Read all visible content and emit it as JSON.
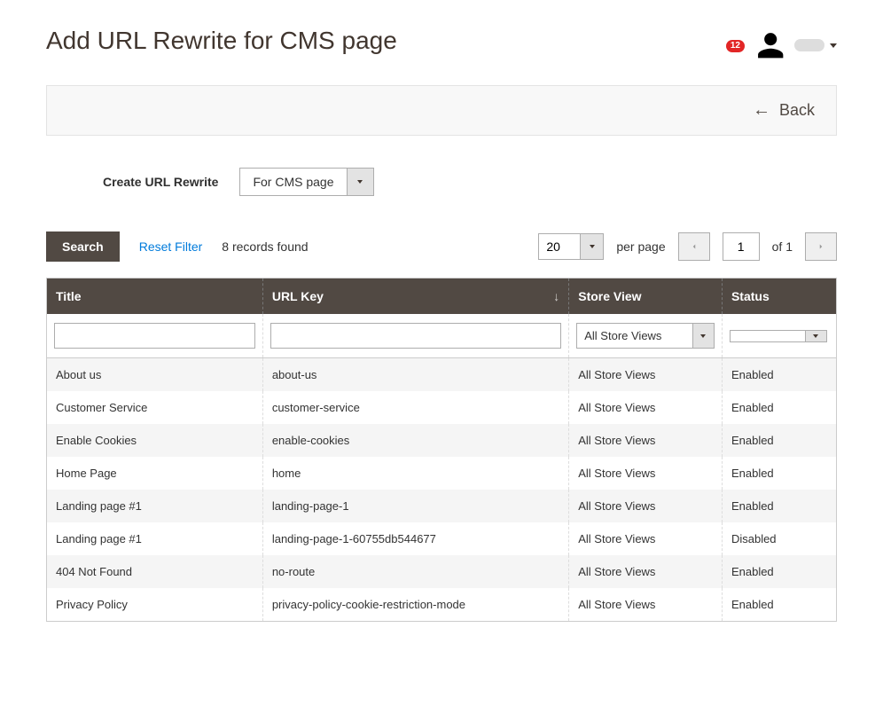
{
  "header": {
    "title": "Add URL Rewrite for CMS page",
    "notifications_count": "12"
  },
  "back_bar": {
    "back_label": "Back"
  },
  "form": {
    "create_label": "Create URL Rewrite",
    "rewrite_type_value": "For CMS page"
  },
  "toolbar": {
    "search_label": "Search",
    "reset_label": "Reset Filter",
    "records_found": "8 records found",
    "per_page_value": "20",
    "per_page_label": "per page",
    "current_page": "1",
    "total_pages_label": "of 1"
  },
  "table": {
    "columns": {
      "title": "Title",
      "url_key": "URL Key",
      "store_view": "Store View",
      "status": "Status"
    },
    "filters": {
      "store_view_value": "All Store Views",
      "status_value": ""
    },
    "rows": [
      {
        "title": "About us",
        "url_key": "about-us",
        "store_view": "All Store Views",
        "status": "Enabled"
      },
      {
        "title": "Customer Service",
        "url_key": "customer-service",
        "store_view": "All Store Views",
        "status": "Enabled"
      },
      {
        "title": "Enable Cookies",
        "url_key": "enable-cookies",
        "store_view": "All Store Views",
        "status": "Enabled"
      },
      {
        "title": "Home Page",
        "url_key": "home",
        "store_view": "All Store Views",
        "status": "Enabled"
      },
      {
        "title": "Landing page #1",
        "url_key": "landing-page-1",
        "store_view": "All Store Views",
        "status": "Enabled"
      },
      {
        "title": "Landing page #1",
        "url_key": "landing-page-1-60755db544677",
        "store_view": "All Store Views",
        "status": "Disabled"
      },
      {
        "title": "404 Not Found",
        "url_key": "no-route",
        "store_view": "All Store Views",
        "status": "Enabled"
      },
      {
        "title": "Privacy Policy",
        "url_key": "privacy-policy-cookie-restriction-mode",
        "store_view": "All Store Views",
        "status": "Enabled"
      }
    ]
  }
}
